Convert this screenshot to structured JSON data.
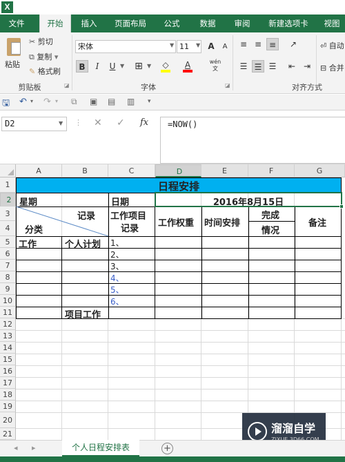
{
  "app": {
    "logo": "X"
  },
  "tabs": [
    "文件",
    "开始",
    "插入",
    "页面布局",
    "公式",
    "数据",
    "审阅",
    "新建选项卡",
    "视图"
  ],
  "ribbon": {
    "clipboard": {
      "paste": "粘贴",
      "cut": "剪切",
      "copy": "复制",
      "format_painter": "格式刷",
      "label": "剪贴板"
    },
    "font": {
      "name": "宋体",
      "size": "11",
      "bold": "B",
      "italic": "I",
      "underline": "U",
      "grow": "A",
      "shrink": "A",
      "wen": "wén",
      "label": "字体"
    },
    "align": {
      "label": "对齐方式",
      "wrap": "自动",
      "merge": "合并"
    }
  },
  "formula_bar": {
    "name_box": "D2",
    "fx": "fx",
    "cancel": "✕",
    "enter": "✓",
    "formula": "=NOW()"
  },
  "columns": [
    "A",
    "B",
    "C",
    "D",
    "E",
    "F",
    "G"
  ],
  "selected_column": "D",
  "rows": [
    "1",
    "2",
    "3",
    "4",
    "5",
    "6",
    "7",
    "8",
    "9",
    "10",
    "11",
    "12",
    "13",
    "14",
    "15",
    "16",
    "17",
    "18",
    "19",
    "20",
    "21"
  ],
  "selected_row": "2",
  "cells": {
    "title": "日程安排",
    "weekday": "星期",
    "date_label": "日期",
    "date_value": "2016年8月15日",
    "record": "记录",
    "category": "分类",
    "project_record_1": "工作项目",
    "project_record_2": "记录",
    "weight": "工作权重",
    "time": "时间安排",
    "complete_1": "完成",
    "complete_2": "情况",
    "note": "备注",
    "work": "工作",
    "personal_plan": "个人计划",
    "items": [
      "1、",
      "2、",
      "3、",
      "4、",
      "5、",
      "6、"
    ],
    "project_work": "项目工作"
  },
  "colors": {
    "accent": "#217346",
    "title_fill": "#00b0f0",
    "blue_text": "#3a5fc8"
  },
  "sheet_tab": "个人日程安排表",
  "add_sheet": "+",
  "watermark": {
    "name": "溜溜自学",
    "url": "ZIXUE.3D66.COM"
  }
}
